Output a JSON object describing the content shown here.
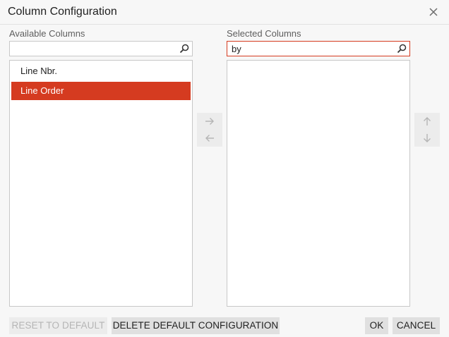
{
  "dialog": {
    "title": "Column Configuration",
    "close_icon": "close-icon"
  },
  "available": {
    "label": "Available Columns",
    "search_value": "",
    "search_icon": "search-icon",
    "items": [
      {
        "label": "Line Nbr.",
        "selected": false
      },
      {
        "label": "Line Order",
        "selected": true
      }
    ]
  },
  "selected": {
    "label": "Selected Columns",
    "search_value": "by",
    "search_icon": "search-icon",
    "items": []
  },
  "move": {
    "right_icon": "arrow-right-icon",
    "left_icon": "arrow-left-icon",
    "up_icon": "arrow-up-icon",
    "down_icon": "arrow-down-icon"
  },
  "footer": {
    "reset_label": "RESET TO DEFAULT",
    "delete_label": "DELETE DEFAULT CONFIGURATION",
    "ok_label": "OK",
    "cancel_label": "CANCEL"
  },
  "colors": {
    "accent": "#d53b20",
    "disabled_text": "#b5b5b5",
    "button_bg": "#e0e0e0"
  }
}
